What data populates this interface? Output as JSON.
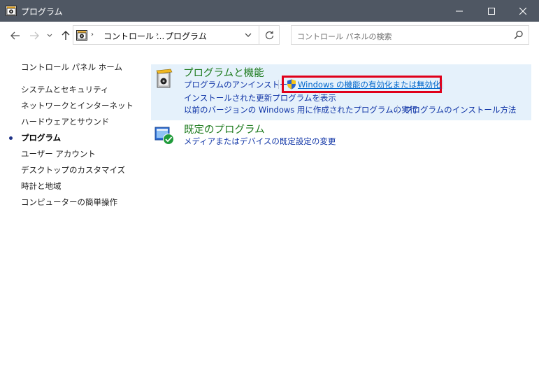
{
  "window": {
    "title": "プログラム",
    "minimize_glyph": "—",
    "maximize_glyph": "☐",
    "close_glyph": "✕"
  },
  "nav": {
    "back_glyph": "←",
    "forward_glyph": "→",
    "recent_glyph": "⌄",
    "up_glyph": "↑"
  },
  "address": {
    "sep1": "›",
    "seg1": "コントロール ...",
    "sep2": "›",
    "seg2": "プログラム",
    "sep3": "›",
    "dropdown_glyph": "⌄",
    "refresh_glyph": "↻"
  },
  "search": {
    "placeholder": "コントロール パネルの検索",
    "icon": "search-icon"
  },
  "sidebar": {
    "home": "コントロール パネル ホーム",
    "items": [
      {
        "label": "システムとセキュリティ",
        "current": false
      },
      {
        "label": "ネットワークとインターネット",
        "current": false
      },
      {
        "label": "ハードウェアとサウンド",
        "current": false
      },
      {
        "label": "プログラム",
        "current": true
      },
      {
        "label": "ユーザー アカウント",
        "current": false
      },
      {
        "label": "デスクトップのカスタマイズ",
        "current": false
      },
      {
        "label": "時計と地域",
        "current": false
      },
      {
        "label": "コンピューターの簡単操作",
        "current": false
      }
    ]
  },
  "categories": [
    {
      "title": "プログラムと機能",
      "icon": "programs-features-icon",
      "links": [
        "プログラムのアンインストール",
        "Windows の機能の有効化または無効化",
        "インストールされた更新プログラムを表示",
        "以前のバージョンの Windows 用に作成されたプログラムの実行",
        "プログラムのインストール方法"
      ]
    },
    {
      "title": "既定のプログラム",
      "icon": "default-programs-icon",
      "links": [
        "メディアまたはデバイスの既定設定の変更"
      ]
    }
  ],
  "colors": {
    "titlebar": "#4f5763",
    "category_title": "#1e7b1e",
    "link": "#0e33a6",
    "highlight_box": "#e0001a",
    "hover_background": "#e5f1fb"
  }
}
